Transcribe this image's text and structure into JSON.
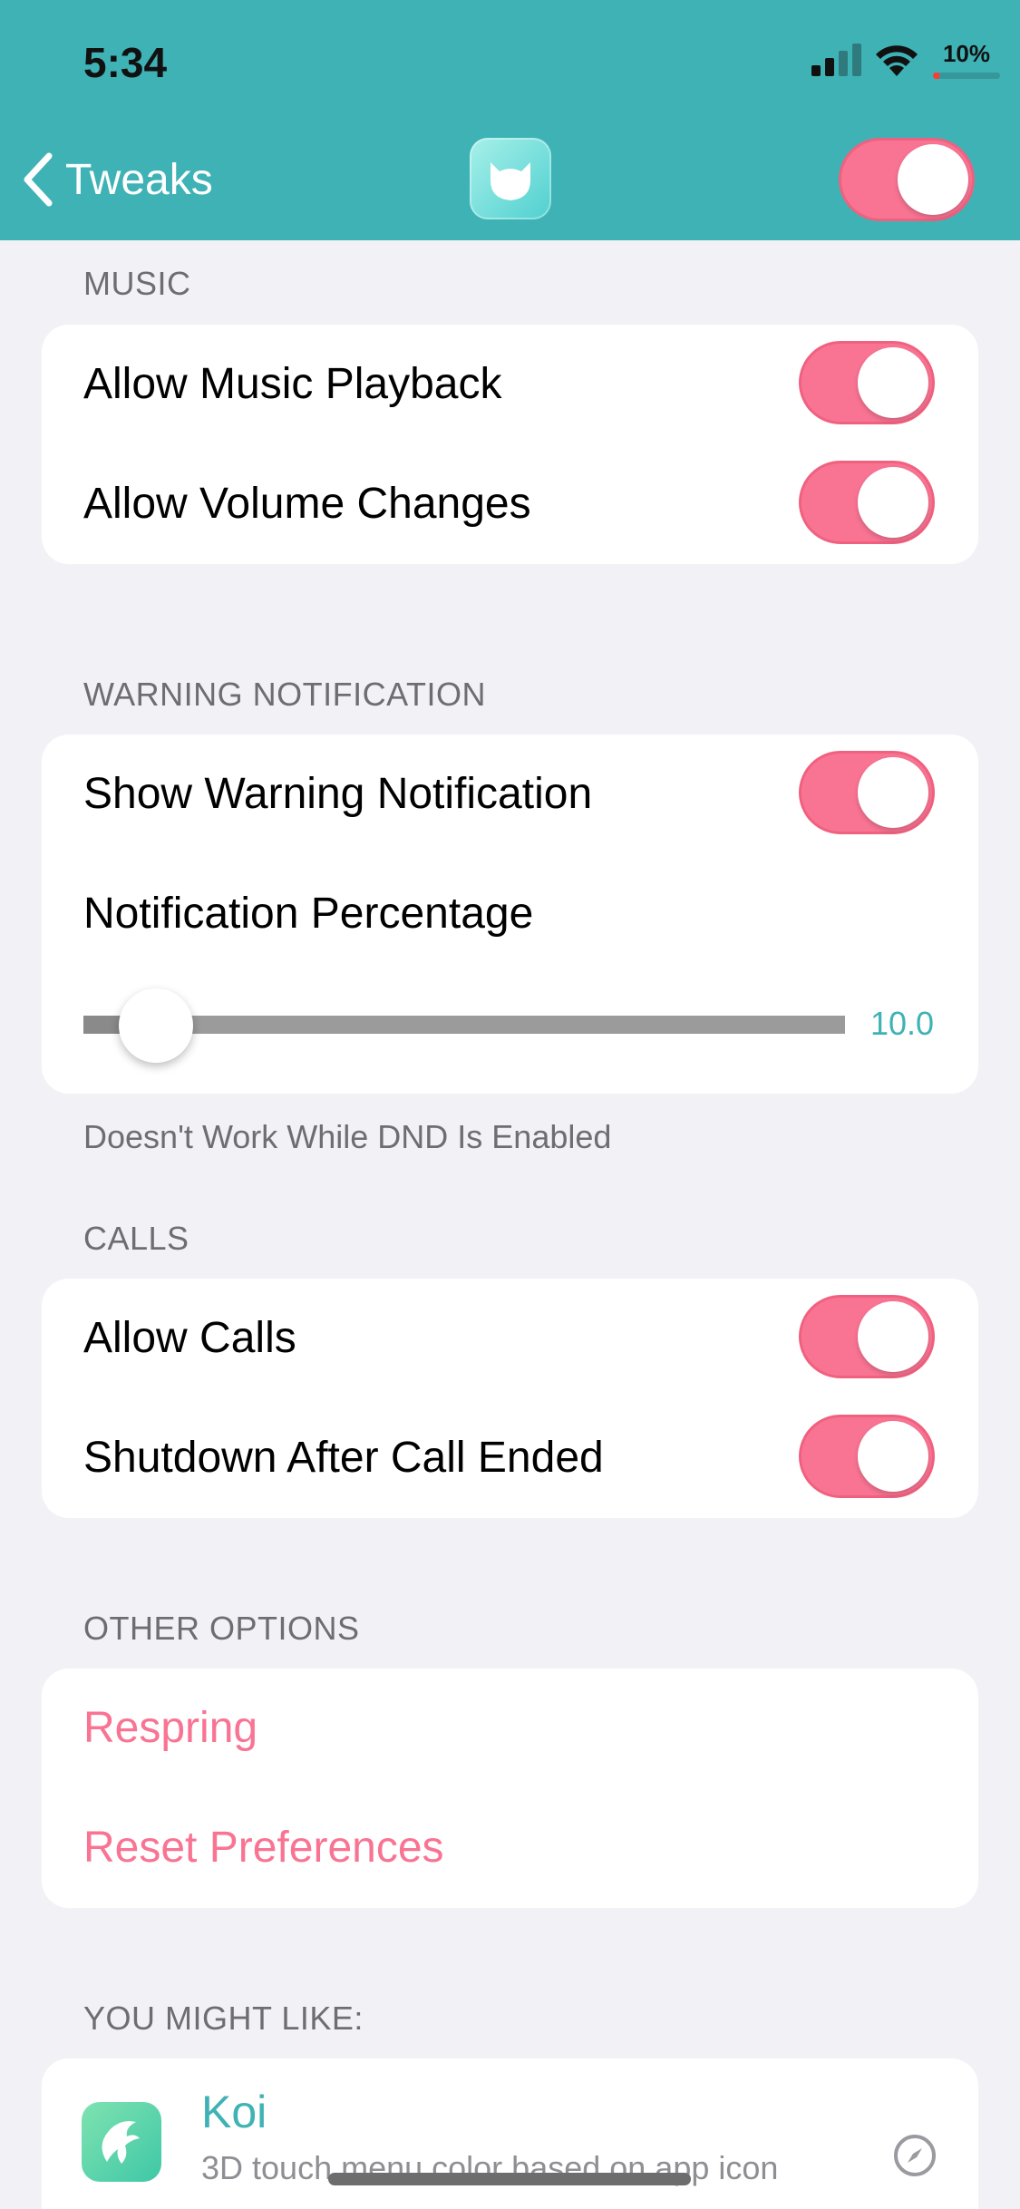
{
  "status_bar": {
    "time": "5:34",
    "battery_text": "10%",
    "battery_level": 0.1
  },
  "nav": {
    "back_label": "Tweaks",
    "master_toggle_on": true
  },
  "sections": {
    "music": {
      "header": "MUSIC",
      "rows": [
        {
          "label": "Allow Music Playback",
          "on": true
        },
        {
          "label": "Allow Volume Changes",
          "on": true
        }
      ]
    },
    "warning": {
      "header": "WARNING NOTIFICATION",
      "show_label": "Show Warning Notification",
      "show_on": true,
      "percentage_label": "Notification Percentage",
      "slider_value": "10.0",
      "slider_fraction": 0.05,
      "footer": "Doesn't Work While DND Is Enabled"
    },
    "calls": {
      "header": "CALLS",
      "rows": [
        {
          "label": "Allow Calls",
          "on": true
        },
        {
          "label": "Shutdown After Call Ended",
          "on": true
        }
      ]
    },
    "other": {
      "header": "OTHER OPTIONS",
      "respring": "Respring",
      "reset": "Reset Preferences"
    },
    "you_might_like": {
      "header": "YOU MIGHT LIKE:",
      "item_title": "Koi",
      "item_subtitle": "3D touch menu color based on app icon",
      "item_icon": "koi-fish-icon"
    }
  },
  "colors": {
    "accent": "#3fb2b5",
    "toggle_pink": "#f97493",
    "background": "#f2f1f6"
  }
}
